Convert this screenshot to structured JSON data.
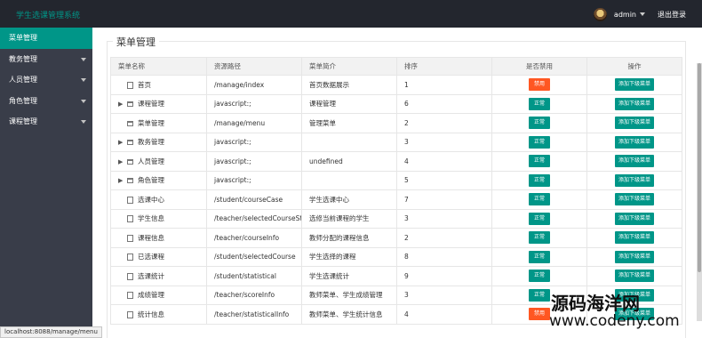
{
  "app_title": "学生选课管理系统",
  "user": {
    "name": "admin",
    "logout": "退出登录"
  },
  "sidebar": {
    "items": [
      {
        "label": "菜单管理",
        "active": true,
        "expandable": false
      },
      {
        "label": "教务管理",
        "active": false,
        "expandable": true
      },
      {
        "label": "人员管理",
        "active": false,
        "expandable": true
      },
      {
        "label": "角色管理",
        "active": false,
        "expandable": true
      },
      {
        "label": "课程管理",
        "active": false,
        "expandable": true
      }
    ]
  },
  "panel_title": "菜单管理",
  "table": {
    "headers": [
      "菜单名称",
      "资源路径",
      "菜单简介",
      "排序",
      "是否禁用",
      "操作"
    ],
    "rows": [
      {
        "name": "首页",
        "path": "/manage/index",
        "desc": "首页数据展示",
        "order": "1",
        "status": "禁用",
        "action": "添加下级菜单",
        "expandable": false,
        "folder": false,
        "disabled": true
      },
      {
        "name": "课程管理",
        "path": "javascript:;",
        "desc": "课程管理",
        "order": "6",
        "status": "正常",
        "action": "添加下级菜单",
        "expandable": true,
        "folder": true,
        "disabled": false
      },
      {
        "name": "菜单管理",
        "path": "/manage/menu",
        "desc": "管理菜单",
        "order": "2",
        "status": "正常",
        "action": "添加下级菜单",
        "expandable": false,
        "folder": true,
        "disabled": false
      },
      {
        "name": "教务管理",
        "path": "javascript:;",
        "desc": "",
        "order": "3",
        "status": "正常",
        "action": "添加下级菜单",
        "expandable": true,
        "folder": true,
        "disabled": false
      },
      {
        "name": "人员管理",
        "path": "javascript:;",
        "desc": "undefined",
        "order": "4",
        "status": "正常",
        "action": "添加下级菜单",
        "expandable": true,
        "folder": true,
        "disabled": false
      },
      {
        "name": "角色管理",
        "path": "javascript:;",
        "desc": "",
        "order": "5",
        "status": "正常",
        "action": "添加下级菜单",
        "expandable": true,
        "folder": true,
        "disabled": false
      },
      {
        "name": "选课中心",
        "path": "/student/courseCase",
        "desc": "学生选课中心",
        "order": "7",
        "status": "正常",
        "action": "添加下级菜单",
        "expandable": false,
        "folder": false,
        "disabled": false
      },
      {
        "name": "学生信息",
        "path": "/teacher/selectedCourseStu",
        "desc": "选修当前课程的学生",
        "order": "3",
        "status": "正常",
        "action": "添加下级菜单",
        "expandable": false,
        "folder": false,
        "disabled": false
      },
      {
        "name": "课程信息",
        "path": "/teacher/courseInfo",
        "desc": "教师分配的课程信息",
        "order": "2",
        "status": "正常",
        "action": "添加下级菜单",
        "expandable": false,
        "folder": false,
        "disabled": false
      },
      {
        "name": "已选课程",
        "path": "/student/selectedCourse",
        "desc": "学生选择的课程",
        "order": "8",
        "status": "正常",
        "action": "添加下级菜单",
        "expandable": false,
        "folder": false,
        "disabled": false
      },
      {
        "name": "选课统计",
        "path": "/student/statistical",
        "desc": "学生选课统计",
        "order": "9",
        "status": "正常",
        "action": "添加下级菜单",
        "expandable": false,
        "folder": false,
        "disabled": false
      },
      {
        "name": "成绩管理",
        "path": "/teacher/scoreInfo",
        "desc": "教师菜单、学生成绩管理",
        "order": "3",
        "status": "正常",
        "action": "添加下级菜单",
        "expandable": false,
        "folder": false,
        "disabled": false
      },
      {
        "name": "统计信息",
        "path": "/teacher/statisticalInfo",
        "desc": "教师菜单、学生统计信息",
        "order": "4",
        "status": "禁用",
        "action": "添加下级菜单",
        "expandable": false,
        "folder": false,
        "disabled": true
      }
    ]
  },
  "status_url": "localhost:8088/manage/menu",
  "watermark": {
    "line1": "源码海洋网",
    "line2": "www.codeny.com"
  },
  "colors": {
    "accent": "#009688",
    "danger": "#ff5722",
    "topbar": "#23262e",
    "sidebar": "#393d49"
  }
}
